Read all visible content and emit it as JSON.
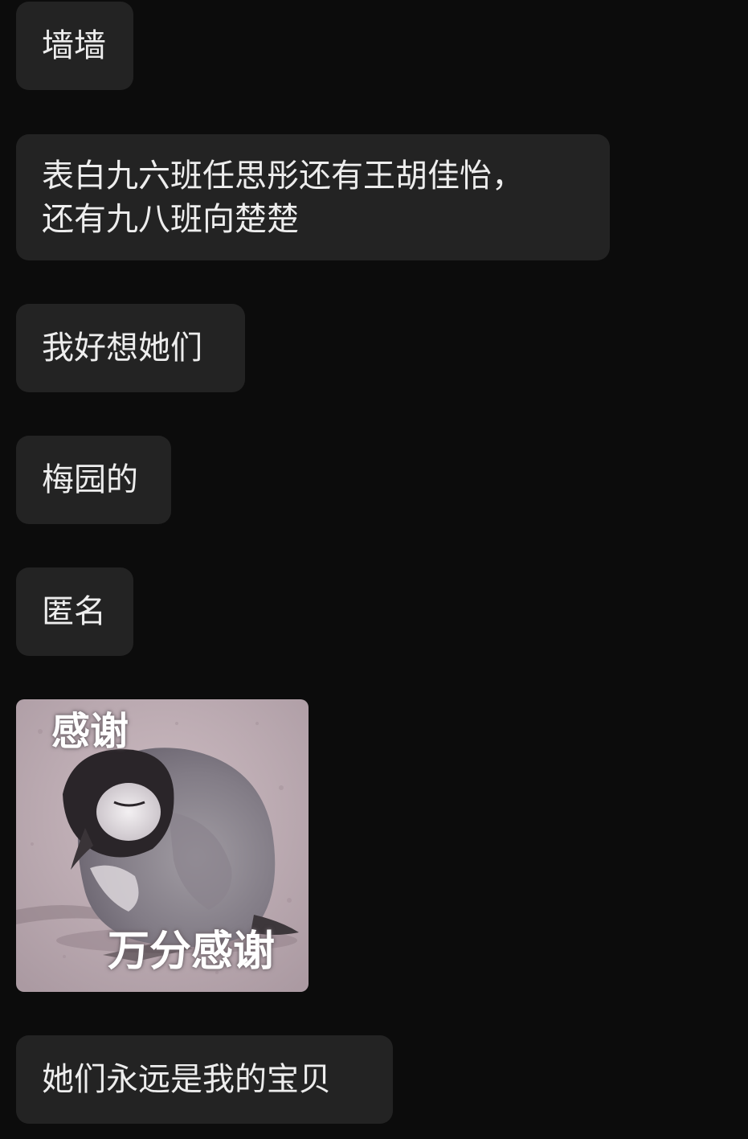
{
  "messages": [
    {
      "text": "墙墙"
    },
    {
      "text": "表白九六班任思彤还有王胡佳怡，还有九八班向楚楚"
    },
    {
      "text": "我好想她们"
    },
    {
      "text": "梅园的"
    },
    {
      "text": "匿名"
    },
    {
      "sticker": {
        "top_caption": "感谢",
        "bottom_caption": "万分感谢",
        "subject": "baby-penguin"
      }
    },
    {
      "text": "她们永远是我的宝贝"
    }
  ],
  "colors": {
    "background": "#0c0c0c",
    "bubble": "#232323",
    "text": "#ededed"
  }
}
